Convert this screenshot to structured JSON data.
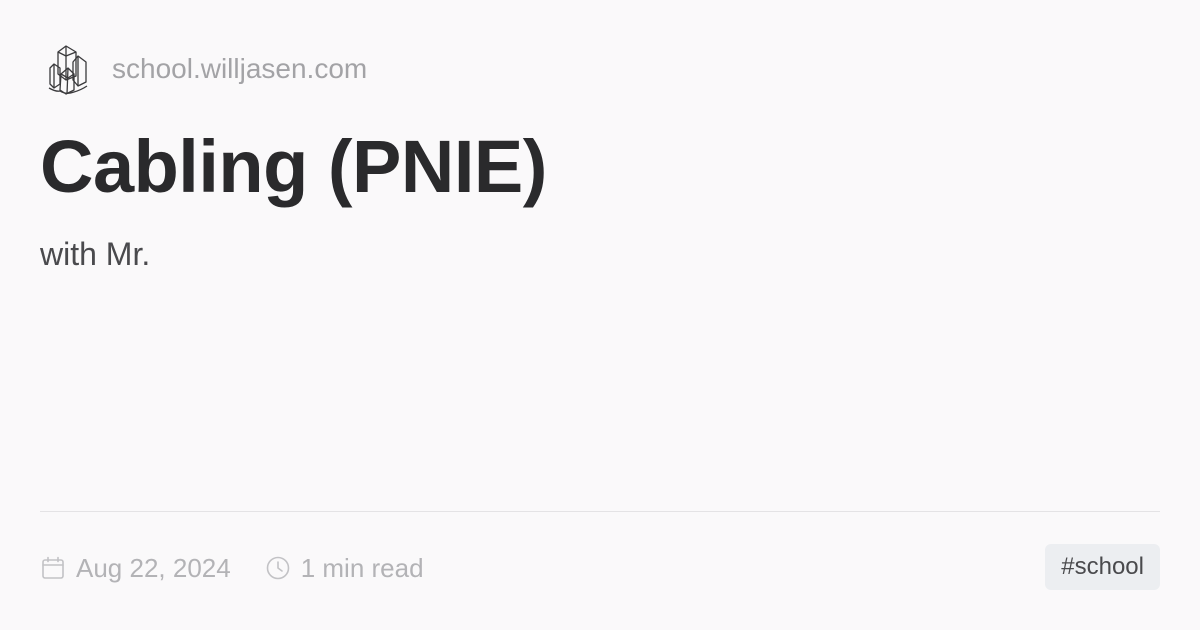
{
  "site": {
    "logo_icon": "crystal-icon",
    "name": "school.willjasen.com"
  },
  "post": {
    "title": "Cabling (PNIE)",
    "subtitle": "with Mr."
  },
  "meta": {
    "date_icon": "calendar-icon",
    "date": "Aug 22, 2024",
    "read_icon": "clock-icon",
    "read_time": "1 min read"
  },
  "tags": [
    {
      "label": "#school"
    }
  ],
  "colors": {
    "background": "#faf9fa",
    "title": "#2a2a2c",
    "muted": "#b3b3b6",
    "tag_background": "#eceef1"
  }
}
